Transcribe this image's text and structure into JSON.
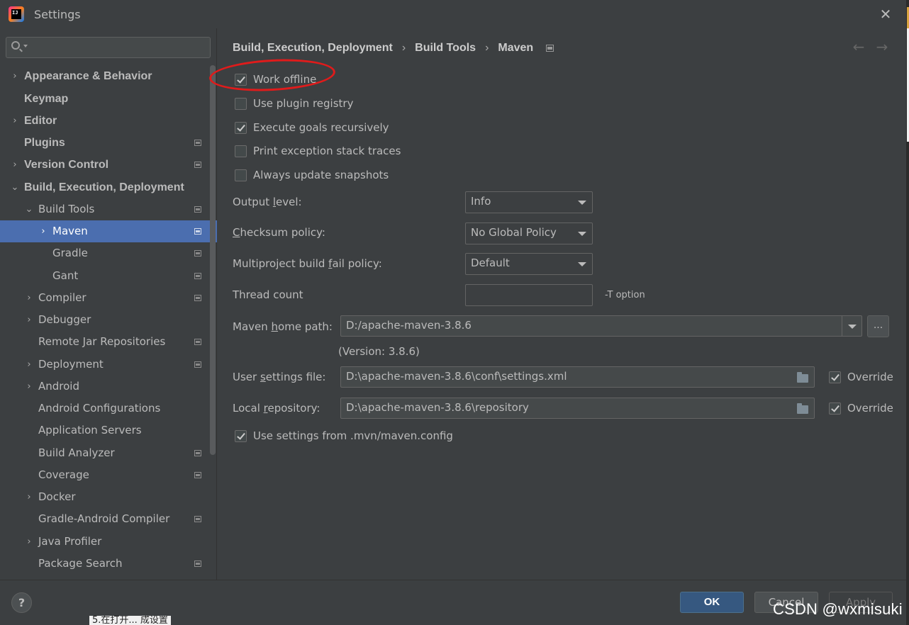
{
  "window": {
    "title": "Settings",
    "close_glyph": "✕",
    "app_icon_text": "IJ"
  },
  "sidebar": {
    "search_placeholder": "",
    "items": [
      {
        "label": "Appearance & Behavior",
        "arrow": "›"
      },
      {
        "label": "Keymap",
        "arrow": ""
      },
      {
        "label": "Editor",
        "arrow": "›"
      },
      {
        "label": "Plugins",
        "arrow": ""
      },
      {
        "label": "Version Control",
        "arrow": "›"
      },
      {
        "label": "Build, Execution, Deployment",
        "arrow": "⌄"
      },
      {
        "label": "Build Tools",
        "arrow": "⌄"
      },
      {
        "label": "Maven",
        "arrow": "›"
      },
      {
        "label": "Gradle",
        "arrow": ""
      },
      {
        "label": "Gant",
        "arrow": ""
      },
      {
        "label": "Compiler",
        "arrow": "›"
      },
      {
        "label": "Debugger",
        "arrow": "›"
      },
      {
        "label": "Remote Jar Repositories",
        "arrow": ""
      },
      {
        "label": "Deployment",
        "arrow": "›"
      },
      {
        "label": "Android",
        "arrow": "›"
      },
      {
        "label": "Android Configurations",
        "arrow": ""
      },
      {
        "label": "Application Servers",
        "arrow": ""
      },
      {
        "label": "Build Analyzer",
        "arrow": ""
      },
      {
        "label": "Coverage",
        "arrow": ""
      },
      {
        "label": "Docker",
        "arrow": "›"
      },
      {
        "label": "Gradle-Android Compiler",
        "arrow": ""
      },
      {
        "label": "Java Profiler",
        "arrow": "›"
      },
      {
        "label": "Package Search",
        "arrow": ""
      }
    ]
  },
  "breadcrumb": {
    "part1": "Build, Execution, Deployment",
    "part2": "Build Tools",
    "part3": "Maven",
    "separator": "›",
    "back_glyph": "←",
    "forward_glyph": "→"
  },
  "options": {
    "work_offline": {
      "label": "Work offline",
      "checked": true
    },
    "use_plugin_registry": {
      "label": "Use plugin registry",
      "checked": false
    },
    "execute_goals_recursively": {
      "label": "Execute goals recursively",
      "checked": true
    },
    "print_exception_stack_traces": {
      "label": "Print exception stack traces",
      "checked": false
    },
    "always_update_snapshots": {
      "label": "Always update snapshots",
      "checked": false
    }
  },
  "form": {
    "output_level": {
      "label_pre": "Output ",
      "label_u": "l",
      "label_post": "evel:",
      "value": "Info"
    },
    "checksum_policy": {
      "label_pre": "",
      "label_u": "C",
      "label_post": "hecksum policy:",
      "value": "No Global Policy"
    },
    "multiproject_fail_policy": {
      "label_pre": "Multiproject build ",
      "label_u": "f",
      "label_post": "ail policy:",
      "value": "Default"
    },
    "thread_count": {
      "label": "Thread count",
      "value": "",
      "hint": "-T option"
    },
    "maven_home": {
      "label_pre": "Maven ",
      "label_u": "h",
      "label_post": "ome path:",
      "value": "D:/apache-maven-3.8.6",
      "version": "(Version: 3.8.6)",
      "browse": "..."
    },
    "user_settings": {
      "label_pre": "User ",
      "label_u": "s",
      "label_post": "ettings file:",
      "value": "D:\\apache-maven-3.8.6\\conf\\settings.xml",
      "override_label": "Override",
      "override_checked": true
    },
    "local_repo": {
      "label_pre": "Local ",
      "label_u": "r",
      "label_post": "epository:",
      "value": "D:\\apache-maven-3.8.6\\repository",
      "override_label": "Override",
      "override_checked": true
    },
    "use_mvn_config": {
      "label": "Use settings from .mvn/maven.config",
      "checked": true
    }
  },
  "footer": {
    "help": "?",
    "ok": "OK",
    "cancel": "Cancel",
    "apply": "Apply"
  },
  "watermark": "CSDN @wxmisuki",
  "bottom_fragment": "5.在打开... 成设置",
  "colors": {
    "selection": "#4b6eaf",
    "annotation_circle": "#e01b1b",
    "ok_button": "#365880"
  }
}
